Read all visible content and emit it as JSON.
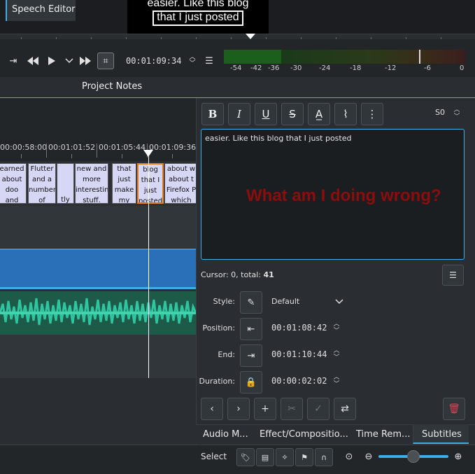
{
  "monitor": {
    "line1": "easier. Like this blog",
    "line2": "that I just posted"
  },
  "transport": {
    "timecode": "00:01:09:34"
  },
  "vu_meter": {
    "labels": [
      "-54",
      "-42",
      "-36",
      "-30",
      "-24",
      "-18",
      "-12",
      "-6",
      "0"
    ]
  },
  "tabs": {
    "speech_editor": "Speech Editor",
    "project_notes": "Project Notes"
  },
  "timeline": {
    "ruler_labels": [
      "00:00:58:00",
      "00:01:01:52",
      "00:01:05:44",
      "00:01:09:36"
    ],
    "subtitles": [
      "earned about doo and then I",
      "Flutter and a number of",
      "tly",
      "new and more interesting stuff.",
      "that just make my life",
      "blog that I just posted",
      "about w about t Firefox P which"
    ]
  },
  "subtitle_panel": {
    "layer_value": "S0",
    "editor_text": "easier. Like this blog that I just posted",
    "overlay_text": "What am I doing wrong?",
    "cursor_label": "Cursor: 0, total: ",
    "cursor_total": "41",
    "style_label": "Style:",
    "style_value": "Default",
    "position_label": "Position:",
    "position_value": "00:01:08:42",
    "end_label": "End:",
    "end_value": "00:01:10:44",
    "duration_label": "Duration:",
    "duration_value": "00:00:02:02"
  },
  "bottom_tabs": {
    "audio": "Audio M...",
    "effects": "Effect/Compositio...",
    "time_remap": "Time Rem...",
    "subtitles": "Subtitles"
  },
  "status_bar": {
    "select_label": "Select"
  },
  "colors": {
    "accent": "#3daee9",
    "selected_clip_border": "#e67e22",
    "overlay_text": "#8b0d0d",
    "delete": "#da4453"
  }
}
